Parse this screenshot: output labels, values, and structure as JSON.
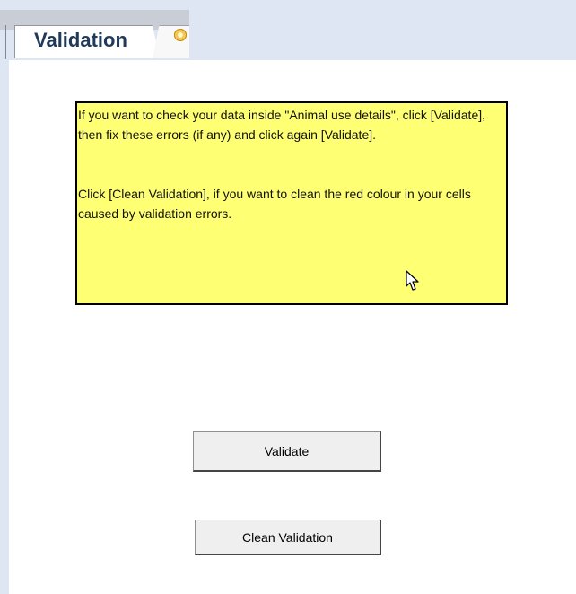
{
  "sheet_tabs": {
    "active": "Validation"
  },
  "instructions": {
    "paragraph_1": "If you want to check your data inside \"Animal use details\", click [Validate], then fix these errors (if any) and click again [Validate].",
    "paragraph_2": "Click [Clean Validation], if you want to clean the red colour in your cells caused by validation errors."
  },
  "buttons": {
    "validate": "Validate",
    "clean_validation": "Clean Validation"
  },
  "icons": {
    "new_sheet": "new-sheet-icon",
    "cursor": "mouse-cursor-icon"
  },
  "colors": {
    "note_background": "#ffff73",
    "tab_strip": "#dde6f2",
    "sheet_background": "#ffffff",
    "button_background": "#efefef"
  }
}
